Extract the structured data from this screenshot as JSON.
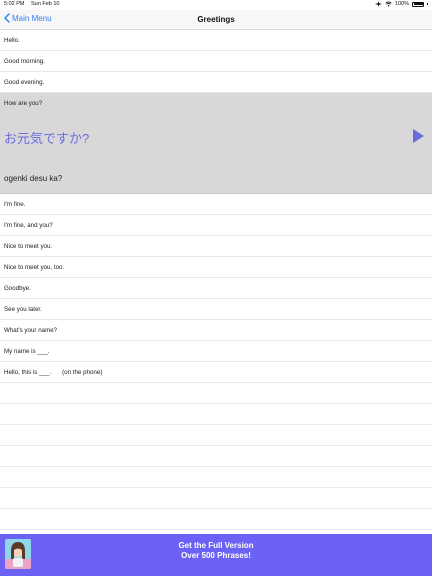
{
  "status": {
    "time": "5:02 PM",
    "date": "Sun Feb 10",
    "battery": "100%"
  },
  "nav": {
    "back_label": "Main Menu",
    "title": "Greetings"
  },
  "phrases_before": [
    {
      "label": "Hello."
    },
    {
      "label": "Good morning."
    },
    {
      "label": "Good evening."
    }
  ],
  "expanded": {
    "english": "How are you?",
    "japanese": "お元気ですか?",
    "romaji": "ogenki desu ka?",
    "accent_color": "#6b6be0"
  },
  "phrases_after": [
    {
      "label": "I'm fine."
    },
    {
      "label": "I'm fine, and you?"
    },
    {
      "label": "Nice to meet you."
    },
    {
      "label": "Nice to meet you, too."
    },
    {
      "label": "Goodbye."
    },
    {
      "label": "See you later."
    },
    {
      "label": "What's your name?"
    },
    {
      "label": "My name is ___."
    },
    {
      "label": "Hello, this is ___.",
      "note": "(on the phone)"
    }
  ],
  "banner": {
    "line1": "Get the Full Version",
    "line2": "Over 500 Phrases!",
    "color": "#6b62f5"
  }
}
